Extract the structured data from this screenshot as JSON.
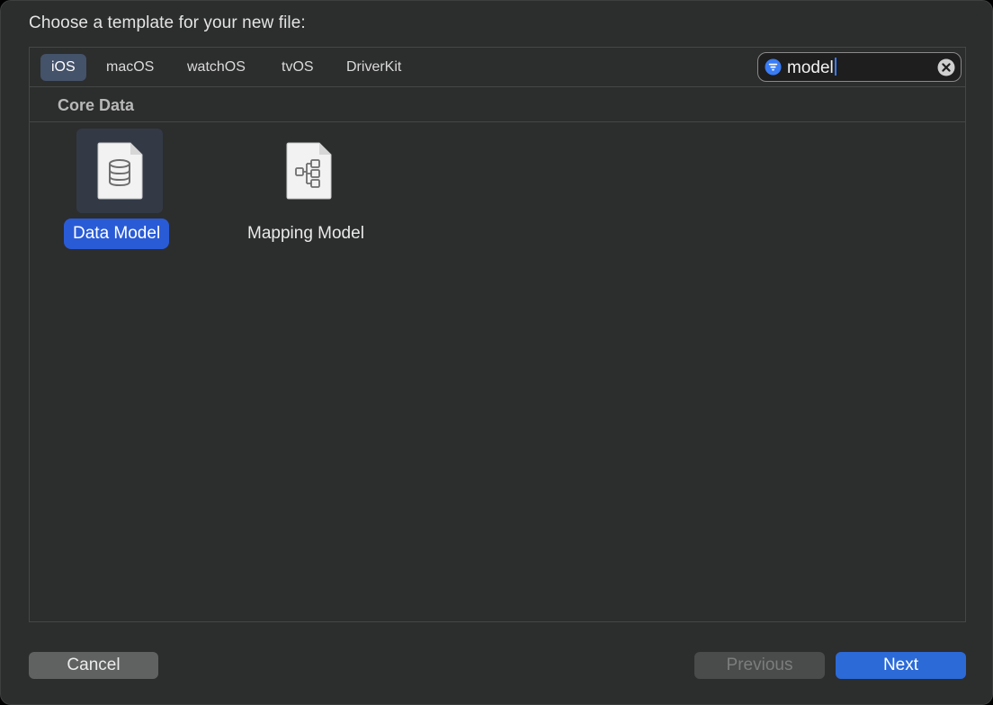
{
  "dialog": {
    "title": "Choose a template for your new file:"
  },
  "platform_tabs": [
    {
      "label": "iOS",
      "selected": true
    },
    {
      "label": "macOS",
      "selected": false
    },
    {
      "label": "watchOS",
      "selected": false
    },
    {
      "label": "tvOS",
      "selected": false
    },
    {
      "label": "DriverKit",
      "selected": false
    }
  ],
  "search": {
    "value": "model",
    "filter_icon": "filter-icon",
    "clear_icon": "clear-icon"
  },
  "section": {
    "title": "Core Data"
  },
  "templates": [
    {
      "label": "Data Model",
      "icon": "database-icon",
      "selected": true
    },
    {
      "label": "Mapping Model",
      "icon": "mapping-icon",
      "selected": false
    }
  ],
  "buttons": {
    "cancel": "Cancel",
    "previous": "Previous",
    "next": "Next",
    "previous_enabled": false
  },
  "colors": {
    "accent": "#2c6ad8",
    "selection": "#2a5bd6",
    "background": "#2c2d2d"
  }
}
